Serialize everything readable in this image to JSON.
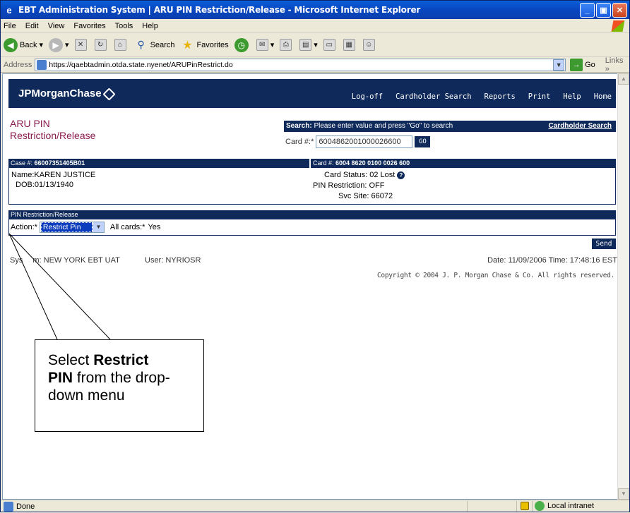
{
  "window": {
    "title": "EBT Administration System | ARU PIN Restriction/Release - Microsoft Internet Explorer",
    "icon": "ie-icon"
  },
  "menu": [
    "File",
    "Edit",
    "View",
    "Favorites",
    "Tools",
    "Help"
  ],
  "toolbar": {
    "back": "Back",
    "search": "Search",
    "favorites": "Favorites"
  },
  "address": {
    "label": "Address",
    "url": "https://qaebtadmin.otda.state.nyenet/ARUPinRestrict.do",
    "go": "Go",
    "links": "Links"
  },
  "header": {
    "brand": "JPMorganChase",
    "nav": [
      "Log-off",
      "Cardholder Search",
      "Reports",
      "Print",
      "Help",
      "Home"
    ]
  },
  "page": {
    "title_line1": "ARU PIN",
    "title_line2": "Restriction/Release"
  },
  "search": {
    "label_bold": "Search:",
    "label_text": "Please enter value and press \"Go\" to search",
    "cardholder_link": "Cardholder Search",
    "card_label": "Card #:*",
    "card_value": "6004862001000026600",
    "go": "GO"
  },
  "case": {
    "case_label": "Case #:",
    "case_number": "66007351405B01",
    "card_label": "Card #:",
    "card_number": "6004 8620 0100 0026 600",
    "name_label": "Name:",
    "name": "KAREN JUSTICE",
    "dob_label": "DOB:",
    "dob": "01/13/1940",
    "card_status_label": "Card Status:",
    "card_status": "02  Lost",
    "pin_restriction_label": "PIN Restriction:",
    "pin_restriction": "OFF",
    "svc_site_label": "Svc Site:",
    "svc_site": "66072"
  },
  "pin": {
    "section_title": "PIN Restriction/Release",
    "action_label": "Action:*",
    "action_value": "Restrict Pin",
    "all_cards_label": "All cards:*",
    "all_cards_value": "Yes",
    "send": "Send"
  },
  "status": {
    "system_label": "Sys",
    "system_suffix": "m: NEW YORK EBT UAT",
    "user_label": "User:",
    "user": "NYRIOSR",
    "date_label": "Date:",
    "date": "11/09/2006",
    "time_label": "Time:",
    "time": "17:48:16 EST",
    "copyright": "Copyright © 2004 J. P. Morgan Chase & Co. All rights reserved."
  },
  "callout": {
    "text_before": "Select ",
    "bold1": "Restrict",
    "bold2": "PIN",
    "text_after": " from the drop-down menu"
  },
  "statusbar": {
    "done": "Done",
    "zone": "Local intranet"
  }
}
